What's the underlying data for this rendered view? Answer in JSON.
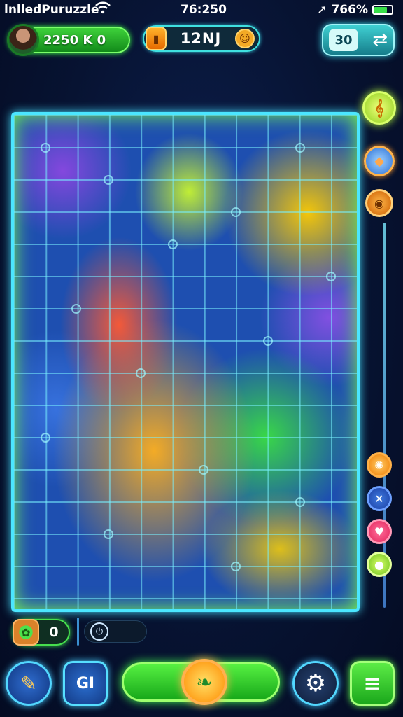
{
  "status_bar": {
    "app_name": "lnlledPuruzzle",
    "time": "76:250",
    "battery": "766%",
    "signal_glyph": "➚"
  },
  "hud": {
    "player_score": "2250 K 0",
    "timer": "12NJ",
    "moves": "30"
  },
  "icons": {
    "wifi": "wifi-icon",
    "timer_face": "☺",
    "shuffle": "⇄",
    "hint": "𝄞",
    "eye": "◉",
    "power": "⏻",
    "brush": "✎",
    "grid_menu": "GI",
    "leaf": "❧",
    "gear": "⚙",
    "list": "≡"
  },
  "footer": {
    "pieces_count": "0"
  },
  "colors": {
    "accent_green": "#3cff44",
    "accent_cyan": "#45e1ff",
    "accent_orange": "#ff9a2a",
    "background": "#071332"
  }
}
